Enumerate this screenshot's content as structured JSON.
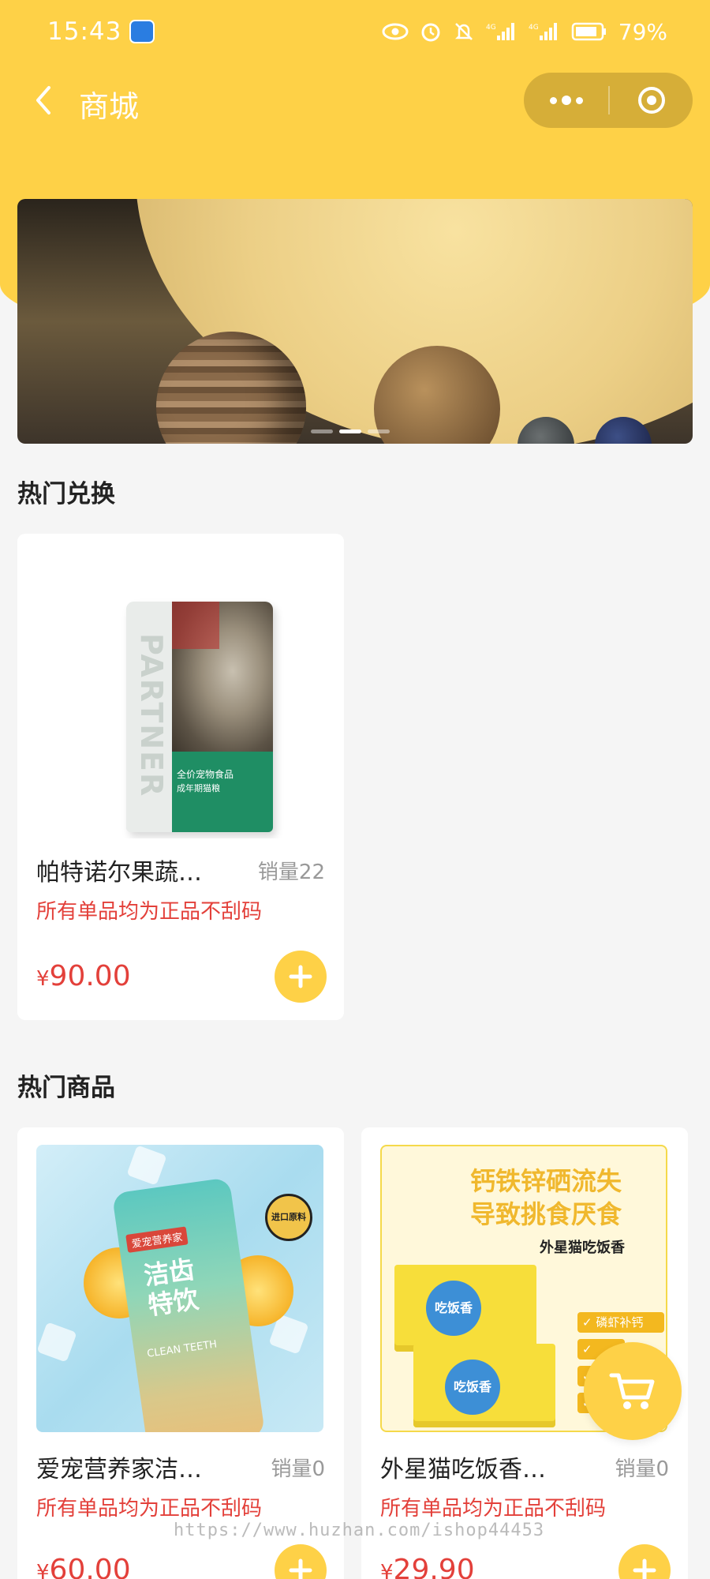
{
  "status_bar": {
    "time": "15:43",
    "battery": "79%",
    "icons": [
      "app-notification-icon",
      "eye-icon",
      "alarm-icon",
      "mute-icon",
      "signal-4g-icon",
      "signal-4g-icon",
      "battery-icon"
    ]
  },
  "nav": {
    "title": "商城",
    "back_icon": "chevron-left-icon",
    "more_icon": "more-dots-icon",
    "close_icon": "target-close-icon"
  },
  "banner": {
    "slide_count": 3,
    "active_index": 1
  },
  "sections": {
    "hot_exchange": "热门兑换",
    "hot_products": "热门商品"
  },
  "hot_exchange_items": [
    {
      "name": "帕特诺尔果蔬…",
      "sales": "销量22",
      "promo": "所有单品均为正品不刮码",
      "currency": "¥",
      "price": "90.00",
      "image_text": [
        "PARTNER",
        "全价宠物食品",
        "成年期猫粮"
      ]
    }
  ],
  "hot_products_items": [
    {
      "name": "爱宠营养家洁…",
      "sales": "销量0",
      "promo": "所有单品均为正品不刮码",
      "currency": "¥",
      "price": "60.00",
      "image_text": [
        "爱宠营养家",
        "洁齿",
        "特饮",
        "CLEAN TEETH",
        "进口原料"
      ]
    },
    {
      "name": "外星猫吃饭香…",
      "sales": "销量0",
      "promo": "所有单品均为正品不刮码",
      "currency": "¥",
      "price": "29.90",
      "image_text": [
        "钙铁锌硒流失",
        "导致挑食厌食",
        "外星猫吃饭香",
        "吃饭香",
        "磷虾补钙"
      ]
    }
  ],
  "floating_cart": {
    "icon": "shopping-cart-icon"
  },
  "watermark": "https://www.huzhan.com/ishop44453",
  "colors": {
    "brand_yellow": "#fed147",
    "price_red": "#e3403a",
    "background": "#f5f5f5"
  }
}
